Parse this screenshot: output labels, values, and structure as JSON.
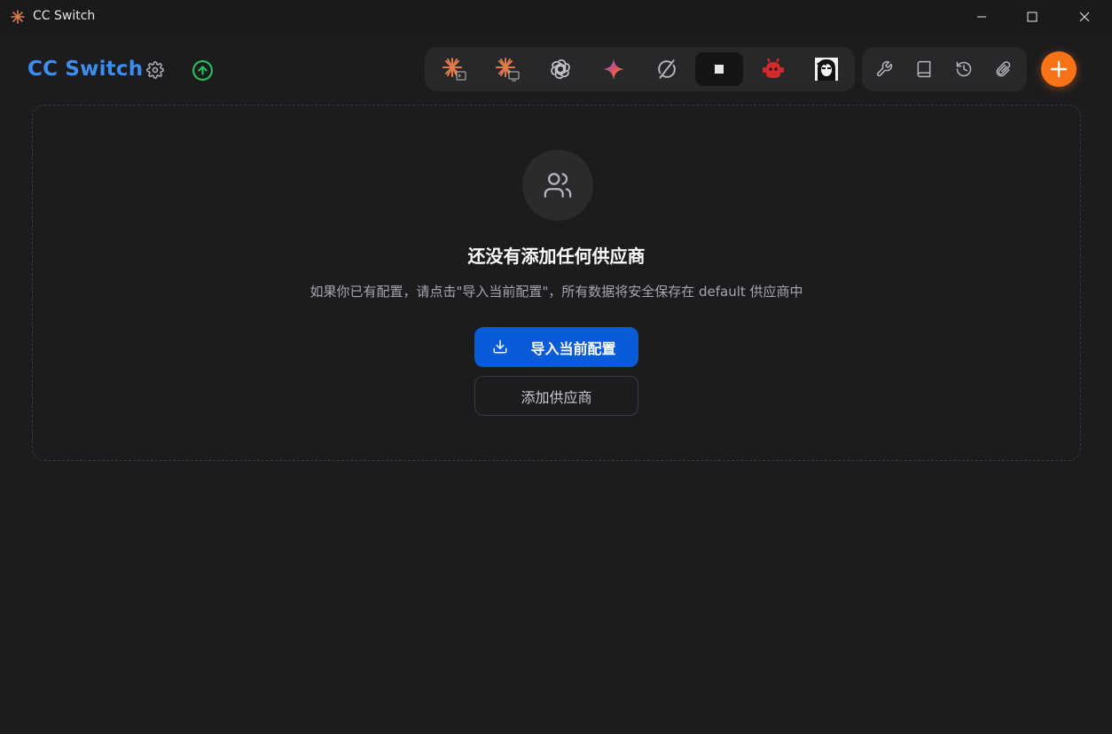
{
  "window": {
    "title": "CC Switch",
    "minimize_icon": "minimize-icon",
    "maximize_icon": "maximize-icon",
    "close_icon": "close-icon"
  },
  "header": {
    "brand": "CC Switch",
    "settings_icon": "gear-icon",
    "update_icon": "arrow-up-circle-icon"
  },
  "apps": [
    {
      "id": "claude-code",
      "icon": "claude-terminal-icon",
      "active": false
    },
    {
      "id": "claude-desktop",
      "icon": "claude-desktop-icon",
      "active": false
    },
    {
      "id": "openai",
      "icon": "openai-icon",
      "active": false
    },
    {
      "id": "gemini",
      "icon": "gemini-icon",
      "active": false
    },
    {
      "id": "sync",
      "icon": "sync-icon",
      "active": false
    },
    {
      "id": "square",
      "icon": "square-icon",
      "active": true
    },
    {
      "id": "mascot",
      "icon": "red-robot-icon",
      "active": false
    },
    {
      "id": "avatar",
      "icon": "portrait-icon",
      "active": false
    }
  ],
  "tools": [
    {
      "id": "tools",
      "icon": "wrench-icon"
    },
    {
      "id": "docs",
      "icon": "book-icon"
    },
    {
      "id": "history",
      "icon": "history-icon"
    },
    {
      "id": "attachment",
      "icon": "paperclip-icon"
    }
  ],
  "add_button_icon": "plus-icon",
  "empty_state": {
    "icon": "users-icon",
    "title": "还没有添加任何供应商",
    "description": "如果你已有配置，请点击\"导入当前配置\"，所有数据将安全保存在 default 供应商中",
    "import_label": "导入当前配置",
    "add_label": "添加供应商"
  },
  "colors": {
    "brand": "#3b8ef0",
    "primary": "#0a5bd8",
    "accent": "#f97316",
    "update_green": "#22c55e",
    "background": "#1c1c1e"
  }
}
